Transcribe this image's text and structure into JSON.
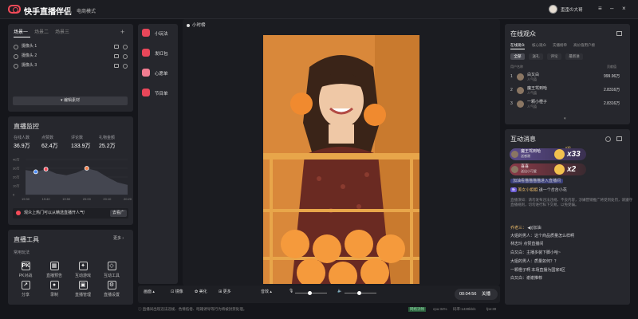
{
  "header": {
    "app_title": "快手直播伴侣",
    "mode": "电商模式",
    "user_name": "歪歪の大哥"
  },
  "scenes": {
    "tabs": [
      "场景一",
      "场景二",
      "场景三"
    ],
    "add": "+",
    "cameras": [
      "摄像头 1",
      "摄像头 2",
      "摄像头 3"
    ],
    "edit_btn": "编辑素材"
  },
  "monitor": {
    "title": "直播监控",
    "stats": [
      {
        "label": "在线人数",
        "value": "36.9万"
      },
      {
        "label": "点赞数",
        "value": "62.4万"
      },
      {
        "label": "评论数",
        "value": "133.9万"
      },
      {
        "label": "礼物金额",
        "value": "25.2万"
      }
    ],
    "chart_data": {
      "type": "area",
      "y_ticks": [
        "40万",
        "30万",
        "20万",
        "10万",
        "0"
      ],
      "x_ticks": [
        "19:30",
        "19:40",
        "19:50",
        "20:00",
        "20:10",
        "20:20"
      ],
      "values": [
        28,
        26,
        29,
        24,
        22,
        25,
        30,
        27,
        20,
        14,
        11
      ]
    },
    "tip": "观众上热门可以从精选直播开人气!",
    "tip_btn": "去看广"
  },
  "tools": {
    "title": "直播工具",
    "more": "更多",
    "section": "常用玩法",
    "items": [
      "PK对战",
      "直播预告",
      "互动游戏",
      "互动工具",
      "分享",
      "录制",
      "直播管理",
      "直播设置"
    ],
    "glyphs": [
      "PK",
      "▦",
      "✦",
      "◇",
      "↗",
      "●",
      "▣",
      "⚙"
    ]
  },
  "side_menu": [
    {
      "label": "小玩法",
      "color": "#e9475a"
    },
    {
      "label": "发红包",
      "color": "#e9475a"
    },
    {
      "label": "心愿单",
      "color": "#f27d91"
    },
    {
      "label": "节目单",
      "color": "#e9475a"
    }
  ],
  "preview": {
    "label": "小时榜"
  },
  "bottom": {
    "screen": "画面",
    "mirror": "镜像",
    "beauty": "美化",
    "more": "更多",
    "volume": "音效",
    "timer": "00:04:56",
    "close": "关播"
  },
  "status": {
    "notice": "直播间出现违法违规、色情低俗、暗箱诱导等行为将被封禁处理。",
    "net": "网络流畅",
    "cpu": "cpu:34%",
    "rate": "码率:1430kb/s",
    "fps": "fps:30"
  },
  "audience": {
    "title": "在线观众",
    "tabs": [
      "在线观众",
      "核心观众",
      "实播榜单",
      "高价值用户榜"
    ],
    "filters": [
      "全部",
      "送礼",
      "评论",
      "最新进"
    ],
    "col_user": "用户名称",
    "col_value": "贡献值",
    "rows": [
      {
        "rank": "1",
        "name": "白又白",
        "sub": "人气值",
        "value": "999.96万"
      },
      {
        "rank": "2",
        "name": "魔王驾到哈",
        "sub": "人气值",
        "value": "2.8316万"
      },
      {
        "rank": "3",
        "name": "一颗小橙子",
        "sub": "人气值",
        "value": "2.8316万"
      }
    ]
  },
  "messages": {
    "title": "互动消息",
    "gifts": [
      {
        "name": "魔王驾到哈",
        "desc": "送感谢",
        "count": "x33",
        "extra": "x10"
      },
      {
        "name": "喜喜",
        "desc": "送出小可爱",
        "count": "x2"
      }
    ],
    "lines": [
      {
        "badge": "",
        "user": "",
        "text": "加油看猫猫猫猫进入直播间"
      },
      {
        "badge": "新",
        "user": "美女小姐姐",
        "text": "送一个合台小花"
      },
      {
        "badge": "",
        "user": "",
        "text": "直播须知：请勿发布违法违规、不良内容，涉嫌营销推广将受到处罚，请遵守"
      },
      {
        "badge": "",
        "user": "",
        "text": "直播规则，切勿进行私下交易，以免受骗。"
      },
      {
        "badge": "",
        "user": "乔老三：",
        "text": "◀))加油"
      },
      {
        "badge": "",
        "user": "",
        "text": "大姐的男人：这个商品质量怎么样啊"
      },
      {
        "badge": "",
        "user": "",
        "text": "林志玲 点赞直播间"
      },
      {
        "badge": "",
        "user": "",
        "text": "白又白：主播多装下脚小哈~"
      },
      {
        "badge": "",
        "user": "",
        "text": "大姐的男人：质量如何？？"
      },
      {
        "badge": "",
        "user": "",
        "text": "一颗橙子啊 本场直播为国家Ⅱ区"
      },
      {
        "badge": "",
        "user": "",
        "text": "白又白：谢谢推荐"
      }
    ]
  }
}
